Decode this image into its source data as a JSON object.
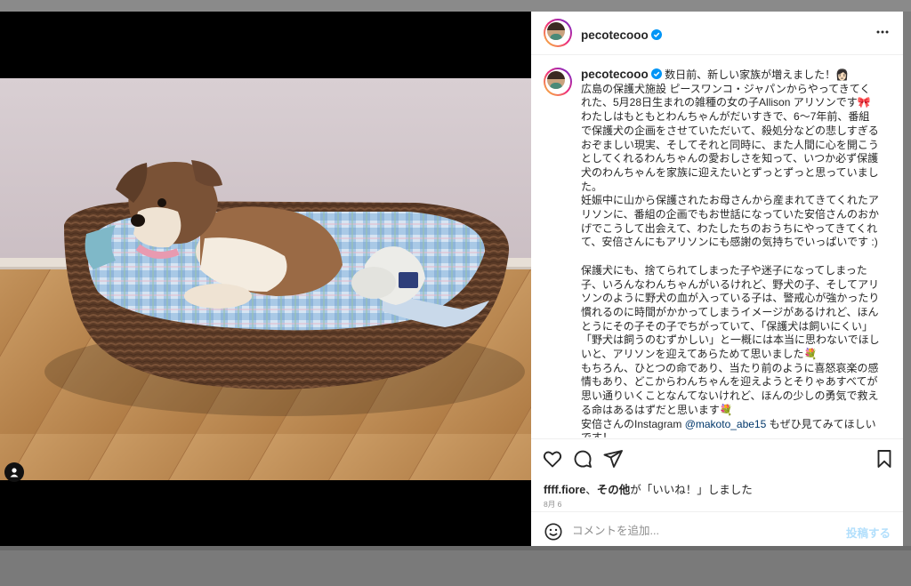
{
  "post": {
    "username": "pecotecooo",
    "caption": {
      "paragraphs": [
        "数日前、新しい家族が増えました！👩🏻\n広島の保護犬施設 ピースワンコ・ジャパンからやってきてくれた、5月28日生まれの雑種の女の子Allison アリソンです🎀\nわたしはもともとわんちゃんがだいすきで、6〜7年前、番組で保護犬の企画をさせていただいて、殺処分などの悲しすぎるおぞましい現実、そしてそれと同時に、また人間に心を開こうとしてくれるわんちゃんの愛おしさを知って、いつか必ず保護犬のわんちゃんを家族に迎えたいとずっとずっと思っていました。\n妊娠中に山から保護されたお母さんから産まれてきてくれたアリソンに、番組の企画でもお世話になっていた安倍さんのおかげでこうして出会えて、わたしたちのおうちにやってきてくれて、安倍さんにもアリソンにも感謝の気持ちでいっぱいです :)",
        "保護犬にも、捨てられてしまった子や迷子になってしまった子、いろんなわんちゃんがいるけれど、野犬の子、そしてアリソンのように野犬の血が入っている子は、警戒心が強かったり慣れるのに時間がかかってしまうイメージがあるけれど、ほんとうにその子その子でちがっていて、「保護犬は飼いにくい」「野犬は飼うのむずかしい」と一概には本当に思わないでほしいと、アリソンを迎えてあらためて思いました💐\nもちろん、ひとつの命であり、当たり前のように喜怒哀楽の感情もあり、どこからわんちゃんを迎えようとそりゃあすべてが思い通りいくことなんてないけれど、ほんの少しの勇気で救える命はあるはずだと思います💐\n安倍さんのInstagram "
      ],
      "mention": "@makoto_abe15",
      "tail": " もぜひ見てみてほしいです！"
    },
    "likes": {
      "user": "ffff.fiore",
      "others": "その他",
      "text": "が「いいね！」しました"
    },
    "date": "8月 6",
    "comment_placeholder": "コメントを追加...",
    "post_button": "投稿する"
  },
  "icons": {
    "more": "more-options-icon",
    "verified": "verified-badge-icon",
    "like": "heart-icon",
    "comment": "comment-bubble-icon",
    "share": "paper-plane-icon",
    "save": "bookmark-icon",
    "emoji": "smiley-icon",
    "tag": "user-tag-icon"
  },
  "colors": {
    "verified": "#0095f6",
    "text": "#262626",
    "muted": "#8e8e8e",
    "mention": "#00376b",
    "post_button_disabled": "#b2dffc"
  }
}
